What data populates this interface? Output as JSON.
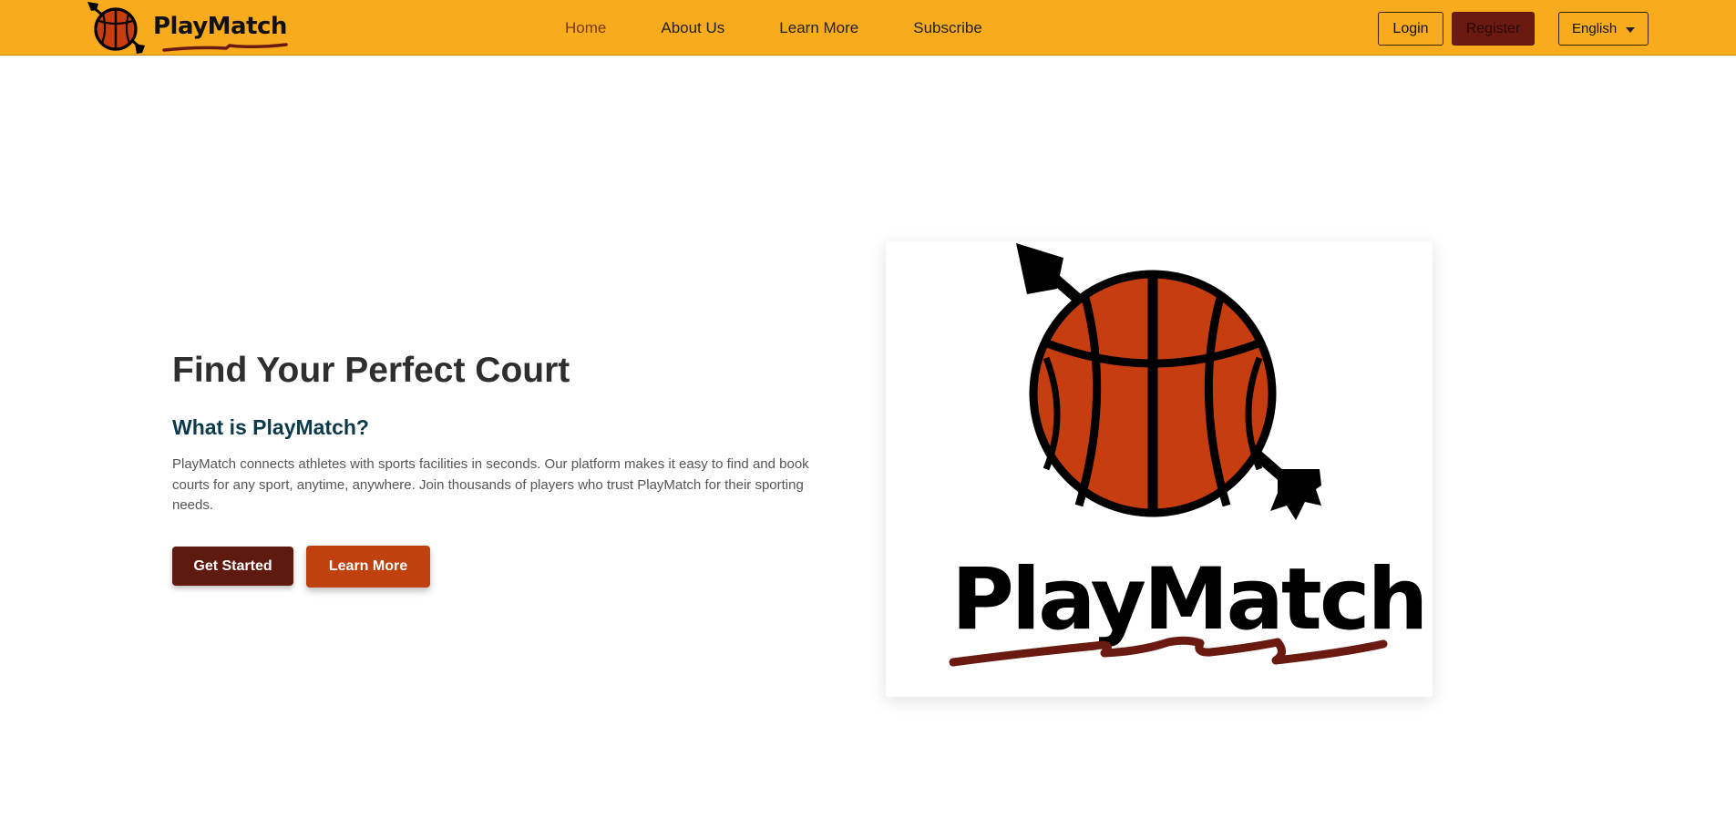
{
  "brand": {
    "name": "PlayMatch",
    "logo_icon": "basketball-arrow-icon"
  },
  "nav": {
    "links": [
      {
        "label": "Home",
        "active": true
      },
      {
        "label": "About Us",
        "active": false
      },
      {
        "label": "Learn More",
        "active": false
      },
      {
        "label": "Subscribe",
        "active": false
      }
    ]
  },
  "auth": {
    "login_label": "Login",
    "register_label": "Register"
  },
  "language": {
    "selected": "English"
  },
  "hero": {
    "title": "Find Your Perfect Court",
    "subtitle": "What is PlayMatch?",
    "description": "PlayMatch connects athletes with sports facilities in seconds. Our platform makes it easy to find and book courts for any sport, anytime, anywhere. Join thousands of players who trust PlayMatch for their sporting needs.",
    "primary_cta": "Get Started",
    "secondary_cta": "Learn More",
    "image_text": "PlayMatch"
  },
  "colors": {
    "header_bg": "#f8ab1d",
    "accent_dark": "#5e1a0e",
    "accent_orange": "#c0400e",
    "ball_orange": "#c63d0f",
    "subtitle_teal": "#0d3a4a"
  }
}
